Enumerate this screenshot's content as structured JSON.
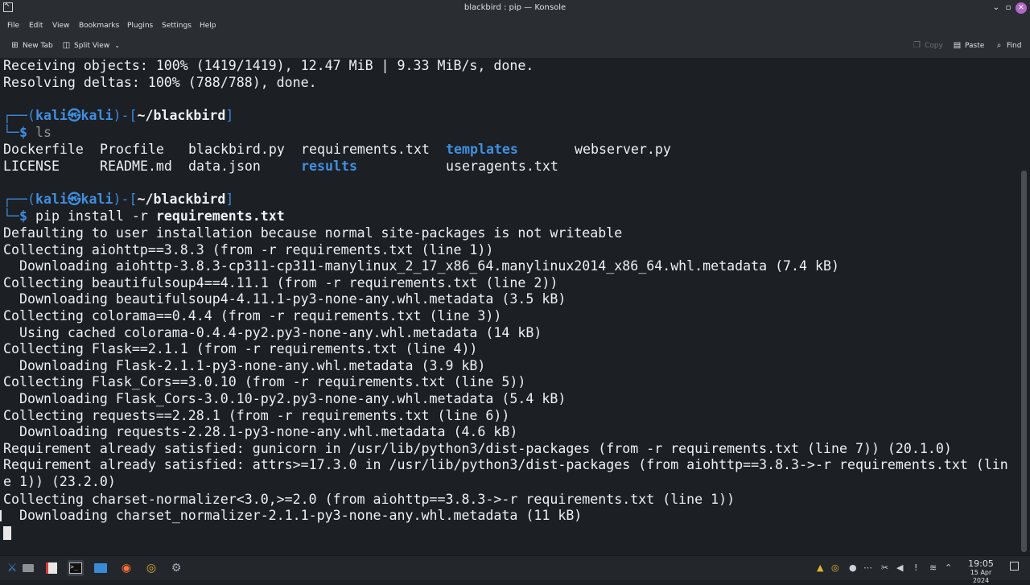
{
  "window": {
    "title": "blackbird : pip — Konsole",
    "controls": [
      "minimize-icon",
      "maximize-icon",
      "close-icon"
    ]
  },
  "menu": [
    "File",
    "Edit",
    "View",
    "Bookmarks",
    "Plugins",
    "Settings",
    "Help"
  ],
  "toolbar": {
    "new_tab": "New Tab",
    "split_view": "Split View",
    "copy": "Copy",
    "paste": "Paste",
    "find": "Find"
  },
  "prompt": {
    "open": "┌──(",
    "user": "kali",
    "at": "㉿",
    "host": "kali",
    "close": ")-[",
    "dir": "~/blackbird",
    "end": "]",
    "second": "└─",
    "dollar": "$"
  },
  "terminal": {
    "line_receiving": "Receiving objects: 100% (1419/1419), 12.47 MiB | 9.33 MiB/s, done.",
    "line_resolving": "Resolving deltas: 100% (788/788), done.",
    "cmd_ls": "ls",
    "ls_files": [
      "Dockerfile",
      "Procfile",
      "blackbird.py",
      "requirements.txt",
      "templates",
      "webserver.py",
      "LICENSE",
      "README.md",
      "data.json",
      "results",
      "useragents.txt"
    ],
    "cmd_pip": "pip install -r",
    "cmd_pip_arg": "requirements.txt",
    "output": [
      "Defaulting to user installation because normal site-packages is not writeable",
      "Collecting aiohttp==3.8.3 (from -r requirements.txt (line 1))",
      "  Downloading aiohttp-3.8.3-cp311-cp311-manylinux_2_17_x86_64.manylinux2014_x86_64.whl.metadata (7.4 kB)",
      "Collecting beautifulsoup4==4.11.1 (from -r requirements.txt (line 2))",
      "  Downloading beautifulsoup4-4.11.1-py3-none-any.whl.metadata (3.5 kB)",
      "Collecting colorama==0.4.4 (from -r requirements.txt (line 3))",
      "  Using cached colorama-0.4.4-py2.py3-none-any.whl.metadata (14 kB)",
      "Collecting Flask==2.1.1 (from -r requirements.txt (line 4))",
      "  Downloading Flask-2.1.1-py3-none-any.whl.metadata (3.9 kB)",
      "Collecting Flask_Cors==3.0.10 (from -r requirements.txt (line 5))",
      "  Downloading Flask_Cors-3.0.10-py2.py3-none-any.whl.metadata (5.4 kB)",
      "Collecting requests==2.28.1 (from -r requirements.txt (line 6))",
      "  Downloading requests-2.28.1-py3-none-any.whl.metadata (4.6 kB)",
      "Requirement already satisfied: gunicorn in /usr/lib/python3/dist-packages (from -r requirements.txt (line 7)) (20.1.0)",
      "Requirement already satisfied: attrs>=17.3.0 in /usr/lib/python3/dist-packages (from aiohttp==3.8.3->-r requirements.txt (lin",
      "e 1)) (23.2.0)",
      "Collecting charset-normalizer<3.0,>=2.0 (from aiohttp==3.8.3->-r requirements.txt (line 1))",
      "  Downloading charset_normalizer-2.1.1-py3-none-any.whl.metadata (11 kB)"
    ]
  },
  "taskbar": {
    "apps": [
      "kali-menu-icon",
      "desktop-icon",
      "text-editor-icon",
      "terminal-icon",
      "file-manager-icon",
      "firefox-icon",
      "chrome-icon",
      "settings-icon"
    ],
    "tray": [
      "notification-icon",
      "chrome-tray-icon",
      "record-icon",
      "dots-icon",
      "network-icon",
      "tools-icon",
      "volume-icon",
      "pin-icon",
      "wifi-icon",
      "expand-tray-icon"
    ],
    "time": "19:05",
    "date": "15 Apr 2024"
  }
}
